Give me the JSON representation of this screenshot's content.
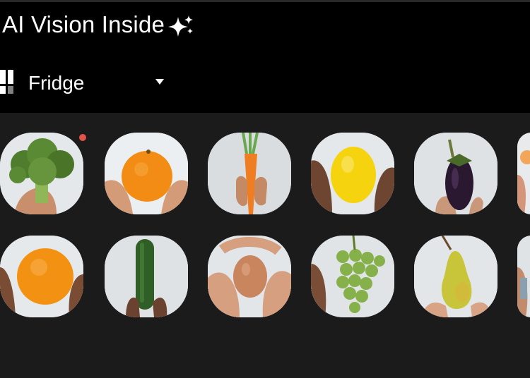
{
  "app": {
    "title": "AI Vision Inside",
    "title_icon": "sparkles-icon"
  },
  "selector": {
    "label": "Fridge",
    "icon": "grid-view-icon",
    "dropdown_icon": "caret-down-icon"
  },
  "colors": {
    "header_bg": "#000000",
    "content_bg": "#1b1b1b",
    "notification_dot": "#e2534a"
  },
  "items": {
    "row1": [
      "broccoli",
      "orange",
      "carrot",
      "lemon",
      "eggplant",
      "partial"
    ],
    "row2": [
      "orange",
      "cucumber",
      "egg",
      "grapes",
      "pear",
      "partial"
    ]
  },
  "notification": {
    "on_item": "broccoli",
    "visible": true
  }
}
